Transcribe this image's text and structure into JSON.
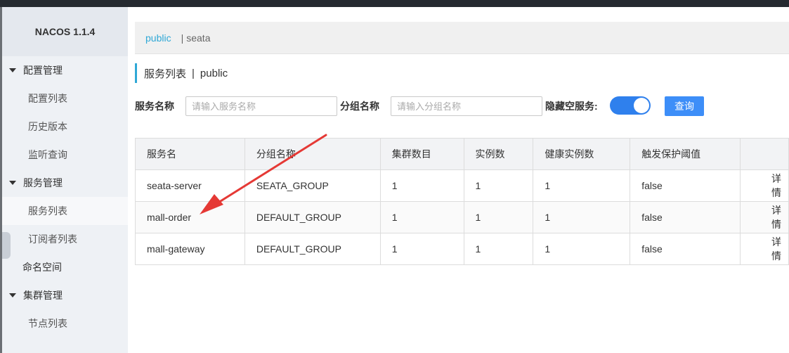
{
  "app": {
    "brand": "NACOS 1.1.4"
  },
  "sidebar": {
    "items": [
      {
        "label": "配置管理",
        "type": "group"
      },
      {
        "label": "配置列表",
        "type": "sub"
      },
      {
        "label": "历史版本",
        "type": "sub"
      },
      {
        "label": "监听查询",
        "type": "sub"
      },
      {
        "label": "服务管理",
        "type": "group"
      },
      {
        "label": "服务列表",
        "type": "sub",
        "active": true
      },
      {
        "label": "订阅者列表",
        "type": "sub"
      },
      {
        "label": "命名空间",
        "type": "plain"
      },
      {
        "label": "集群管理",
        "type": "group"
      },
      {
        "label": "节点列表",
        "type": "sub"
      }
    ]
  },
  "namespace_bar": {
    "active": "public",
    "separator": "|",
    "other": "seata"
  },
  "page": {
    "title": "服务列表",
    "pipe": "|",
    "namespace": "public"
  },
  "search": {
    "service_name_label": "服务名称",
    "service_name_placeholder": "请输入服务名称",
    "group_name_label": "分组名称",
    "group_name_placeholder": "请输入分组名称",
    "hide_empty_label": "隐藏空服务:",
    "hide_empty_on": true,
    "query_label": "查询"
  },
  "table": {
    "headers": [
      "服务名",
      "分组名称",
      "集群数目",
      "实例数",
      "健康实例数",
      "触发保护阈值",
      ""
    ],
    "rows": [
      [
        "seata-server",
        "SEATA_GROUP",
        "1",
        "1",
        "1",
        "false",
        "详情"
      ],
      [
        "mall-order",
        "DEFAULT_GROUP",
        "1",
        "1",
        "1",
        "false",
        "详情"
      ],
      [
        "mall-gateway",
        "DEFAULT_GROUP",
        "1",
        "1",
        "1",
        "false",
        "详情"
      ]
    ]
  },
  "colors": {
    "accent": "#2fa8d6",
    "primary": "#3d8ef8",
    "annotation": "#e53935"
  }
}
